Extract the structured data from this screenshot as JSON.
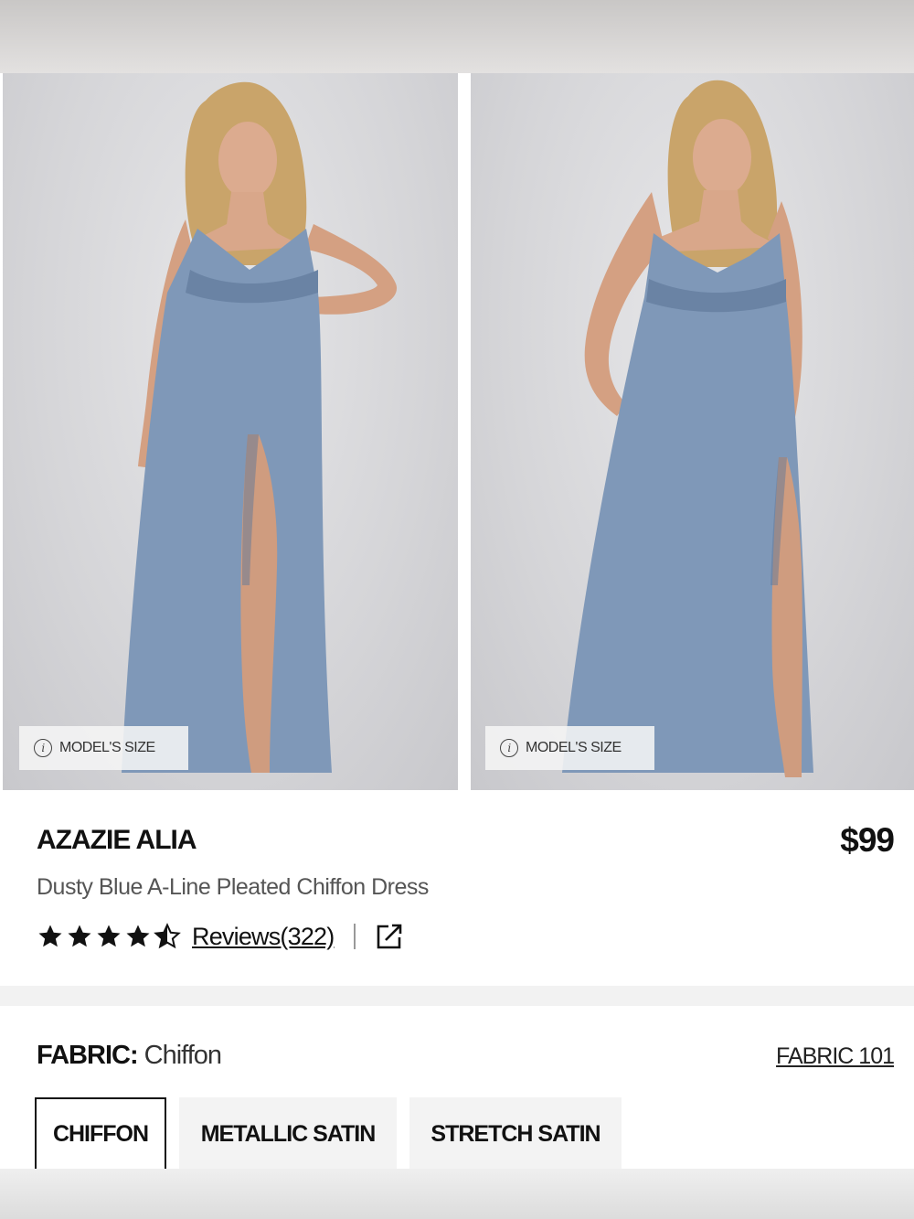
{
  "gallery": {
    "images": [
      {
        "alt": "",
        "model_size_label": "MODEL'S SIZE"
      },
      {
        "alt": "",
        "model_size_label": "MODEL'S SIZE"
      }
    ]
  },
  "product": {
    "name": "AZAZIE ALIA",
    "price": "$99",
    "subtitle": "Dusty Blue A-Line Pleated Chiffon Dress",
    "rating": 4.5,
    "reviews_label": "Reviews(322)"
  },
  "fabric": {
    "label_key": "FABRIC:",
    "label_value": "Chiffon",
    "guide_link": "FABRIC 101",
    "options": [
      {
        "label": "CHIFFON",
        "selected": true
      },
      {
        "label": "METALLIC SATIN",
        "selected": false
      },
      {
        "label": "STRETCH SATIN",
        "selected": false
      }
    ]
  },
  "colors": {
    "dress": "#7f98b8",
    "dress_shadow": "#6a83a4",
    "skin": "#d9a78a",
    "hair": "#c9a46a",
    "text": "#111111",
    "muted_text": "#555555"
  }
}
